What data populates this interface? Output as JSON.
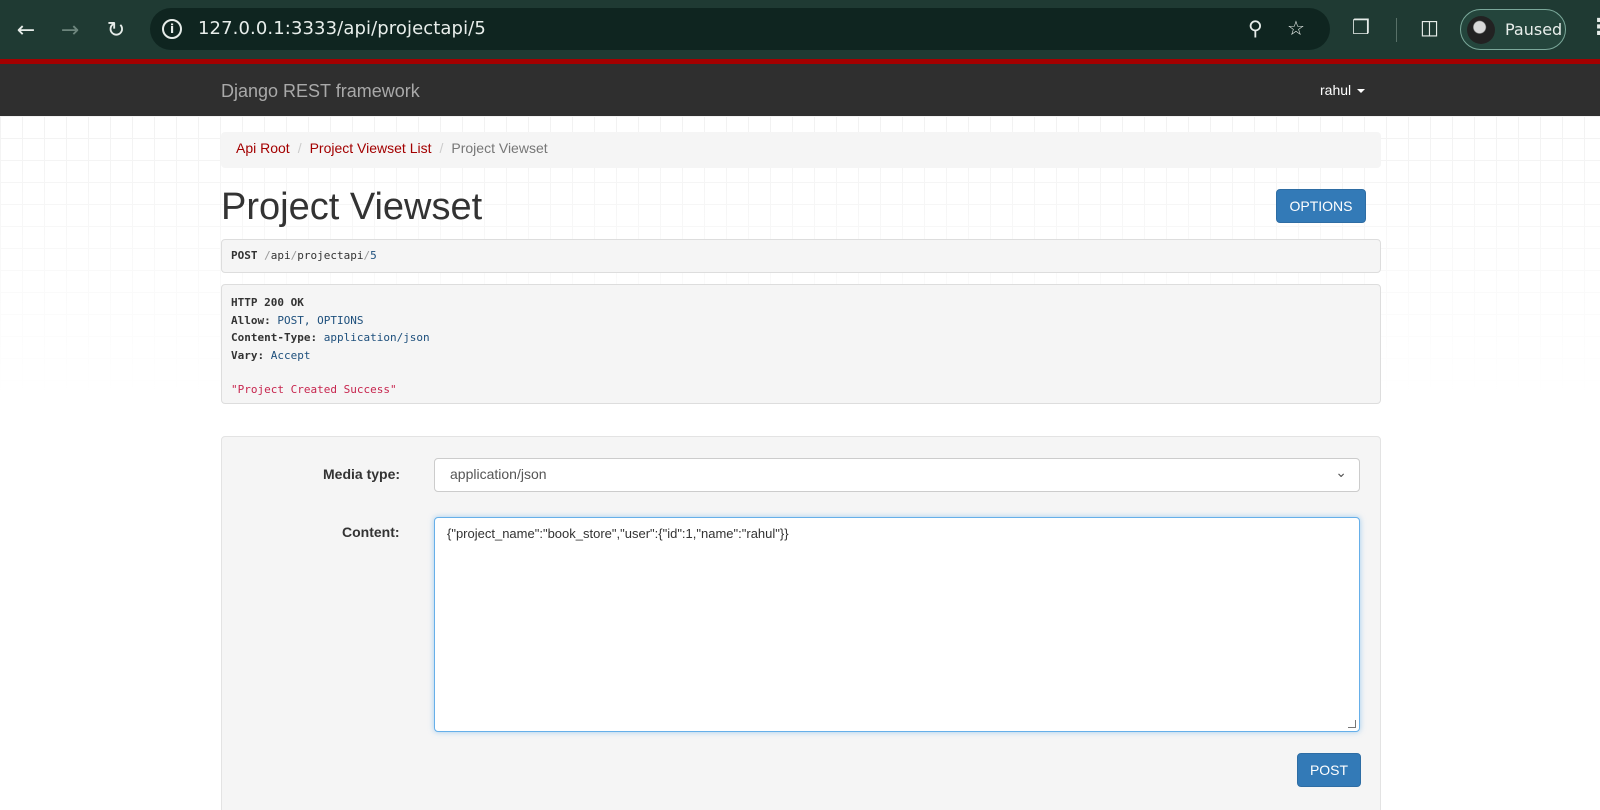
{
  "browser": {
    "url": "127.0.0.1:3333/api/projectapi/5",
    "profile_status": "Paused"
  },
  "navbar": {
    "brand": "Django REST framework",
    "user": "rahul"
  },
  "breadcrumb": {
    "items": [
      "Api Root",
      "Project Viewset List"
    ],
    "active": "Project Viewset"
  },
  "page": {
    "title": "Project Viewset",
    "options_label": "OPTIONS"
  },
  "request": {
    "method": "POST",
    "path_parts": [
      "api",
      "projectapi",
      "5"
    ]
  },
  "response": {
    "status": "HTTP 200 OK",
    "headers": [
      {
        "name": "Allow:",
        "value": "POST, OPTIONS"
      },
      {
        "name": "Content-Type:",
        "value": "application/json"
      },
      {
        "name": "Vary:",
        "value": "Accept"
      }
    ],
    "body": "\"Project Created Success\""
  },
  "form": {
    "media_type_label": "Media type:",
    "media_type_value": "application/json",
    "content_label": "Content:",
    "content_value": "{\"project_name\":\"book_store\",\"user\":{\"id\":1,\"name\":\"rahul\"}}",
    "submit_label": "POST"
  }
}
